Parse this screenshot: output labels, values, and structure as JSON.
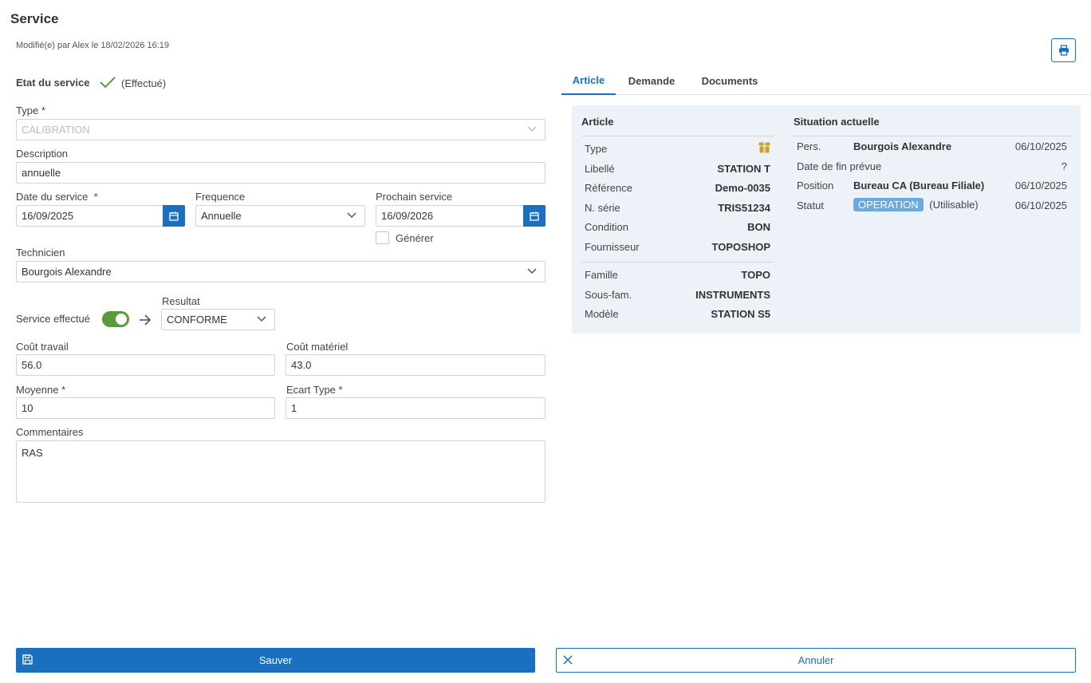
{
  "header": {
    "title": "Service",
    "modified": "Modifié(e) par Alex le 18/02/2026 16:19"
  },
  "state": {
    "label": "Etat du service",
    "value": "(Effectué)"
  },
  "form": {
    "type": {
      "label": "Type",
      "required": "*",
      "value": "CALIBRATION"
    },
    "description": {
      "label": "Description",
      "value": "annuelle"
    },
    "service_date": {
      "label": "Date du service",
      "required": "*",
      "value": "16/09/2025"
    },
    "frequency": {
      "label": "Frequence",
      "value": "Annuelle"
    },
    "next_service": {
      "label": "Prochain service",
      "value": "16/09/2026"
    },
    "generate": {
      "label": "Générer"
    },
    "technician": {
      "label": "Technicien",
      "value": "Bourgois Alexandre"
    },
    "service_done": {
      "label": "Service effectué"
    },
    "result": {
      "label": "Resultat",
      "value": "CONFORME"
    },
    "labor_cost": {
      "label": "Coût travail",
      "value": "56.0"
    },
    "material_cost": {
      "label": "Coût matériel",
      "value": "43.0"
    },
    "mean": {
      "label": "Moyenne",
      "required": "*",
      "value": "10"
    },
    "std_dev": {
      "label": "Ecart Type",
      "required": "*",
      "value": "1"
    },
    "comments": {
      "label": "Commentaires",
      "value": "RAS"
    }
  },
  "tabs": [
    {
      "label": "Article"
    },
    {
      "label": "Demande"
    },
    {
      "label": "Documents"
    }
  ],
  "article": {
    "title": "Article",
    "rows": [
      {
        "label": "Type",
        "value": ""
      },
      {
        "label": "Libellé",
        "value": "STATION T"
      },
      {
        "label": "Référence",
        "value": "Demo-0035"
      },
      {
        "label": "N. série",
        "value": "TRIS51234"
      },
      {
        "label": "Condition",
        "value": "BON"
      },
      {
        "label": "Fournisseur",
        "value": "TOPOSHOP"
      }
    ],
    "rows2": [
      {
        "label": "Famille",
        "value": "TOPO"
      },
      {
        "label": "Sous-fam.",
        "value": "INSTRUMENTS"
      },
      {
        "label": "Modèle",
        "value": "STATION S5"
      }
    ]
  },
  "situation": {
    "title": "Situation actuelle",
    "pers": {
      "label": "Pers.",
      "value": "Bourgois Alexandre",
      "date": "06/10/2025"
    },
    "end_date": {
      "label": "Date de fin prévue",
      "value": "?"
    },
    "position": {
      "label": "Position",
      "value": "Bureau CA (Bureau Filiale)",
      "date": "06/10/2025"
    },
    "status": {
      "label": "Statut",
      "badge": "OPERATION",
      "value": "(Utilisable)",
      "date": "06/10/2025"
    }
  },
  "buttons": {
    "save": "Sauver",
    "cancel": "Annuler"
  },
  "colors": {
    "primary": "#1a6fbf",
    "success": "#5a9a3a",
    "panel_bg": "#edf2f8",
    "badge": "#6aaae0",
    "type_icon": "#c9a227"
  }
}
